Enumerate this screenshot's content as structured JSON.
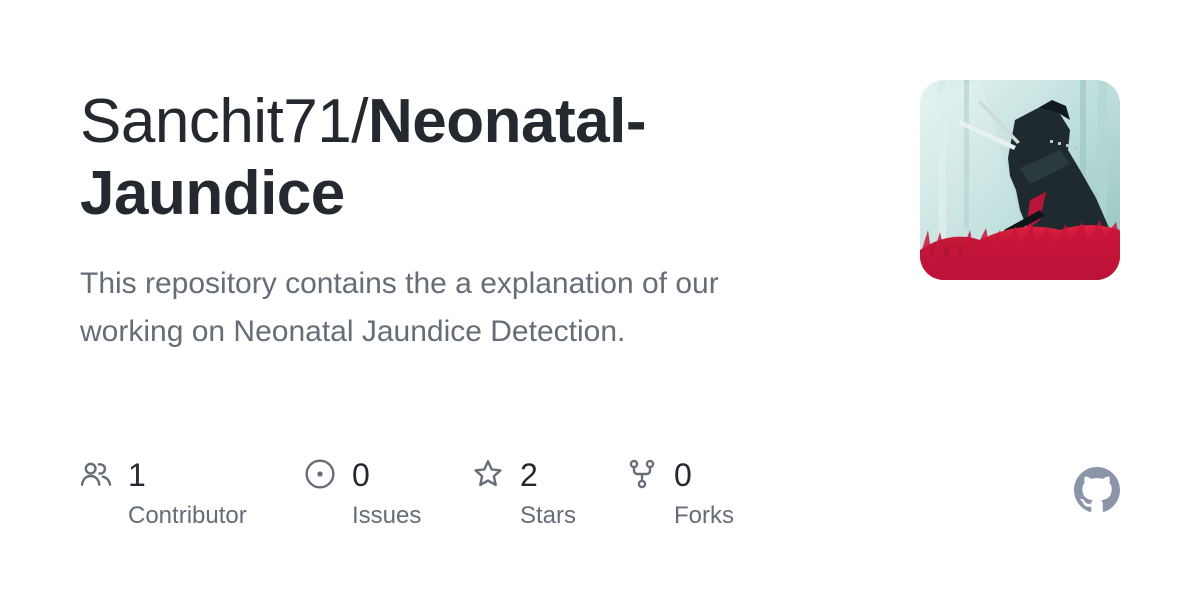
{
  "repo_card": {
    "owner": "Sanchit71/",
    "name_line1": "Neonatal-",
    "name_line2": "Jaundice",
    "description_line1": "This repository contains the a explanation of our",
    "description_line2": "working on Neonatal Jaundice Detection.",
    "avatar_icon": "samurai-avatar",
    "logo_icon": "github-octocat-icon"
  },
  "stats": [
    {
      "icon": "people-icon",
      "value": "1",
      "label": "Contributor"
    },
    {
      "icon": "issue-circle-icon",
      "value": "0",
      "label": "Issues"
    },
    {
      "icon": "star-icon",
      "value": "2",
      "label": "Stars"
    },
    {
      "icon": "fork-icon",
      "value": "0",
      "label": "Forks"
    }
  ],
  "colors": {
    "title": "#24292f",
    "muted": "#656d76",
    "logo": "#8b95a8",
    "avatar_accent": "#c8143c"
  }
}
